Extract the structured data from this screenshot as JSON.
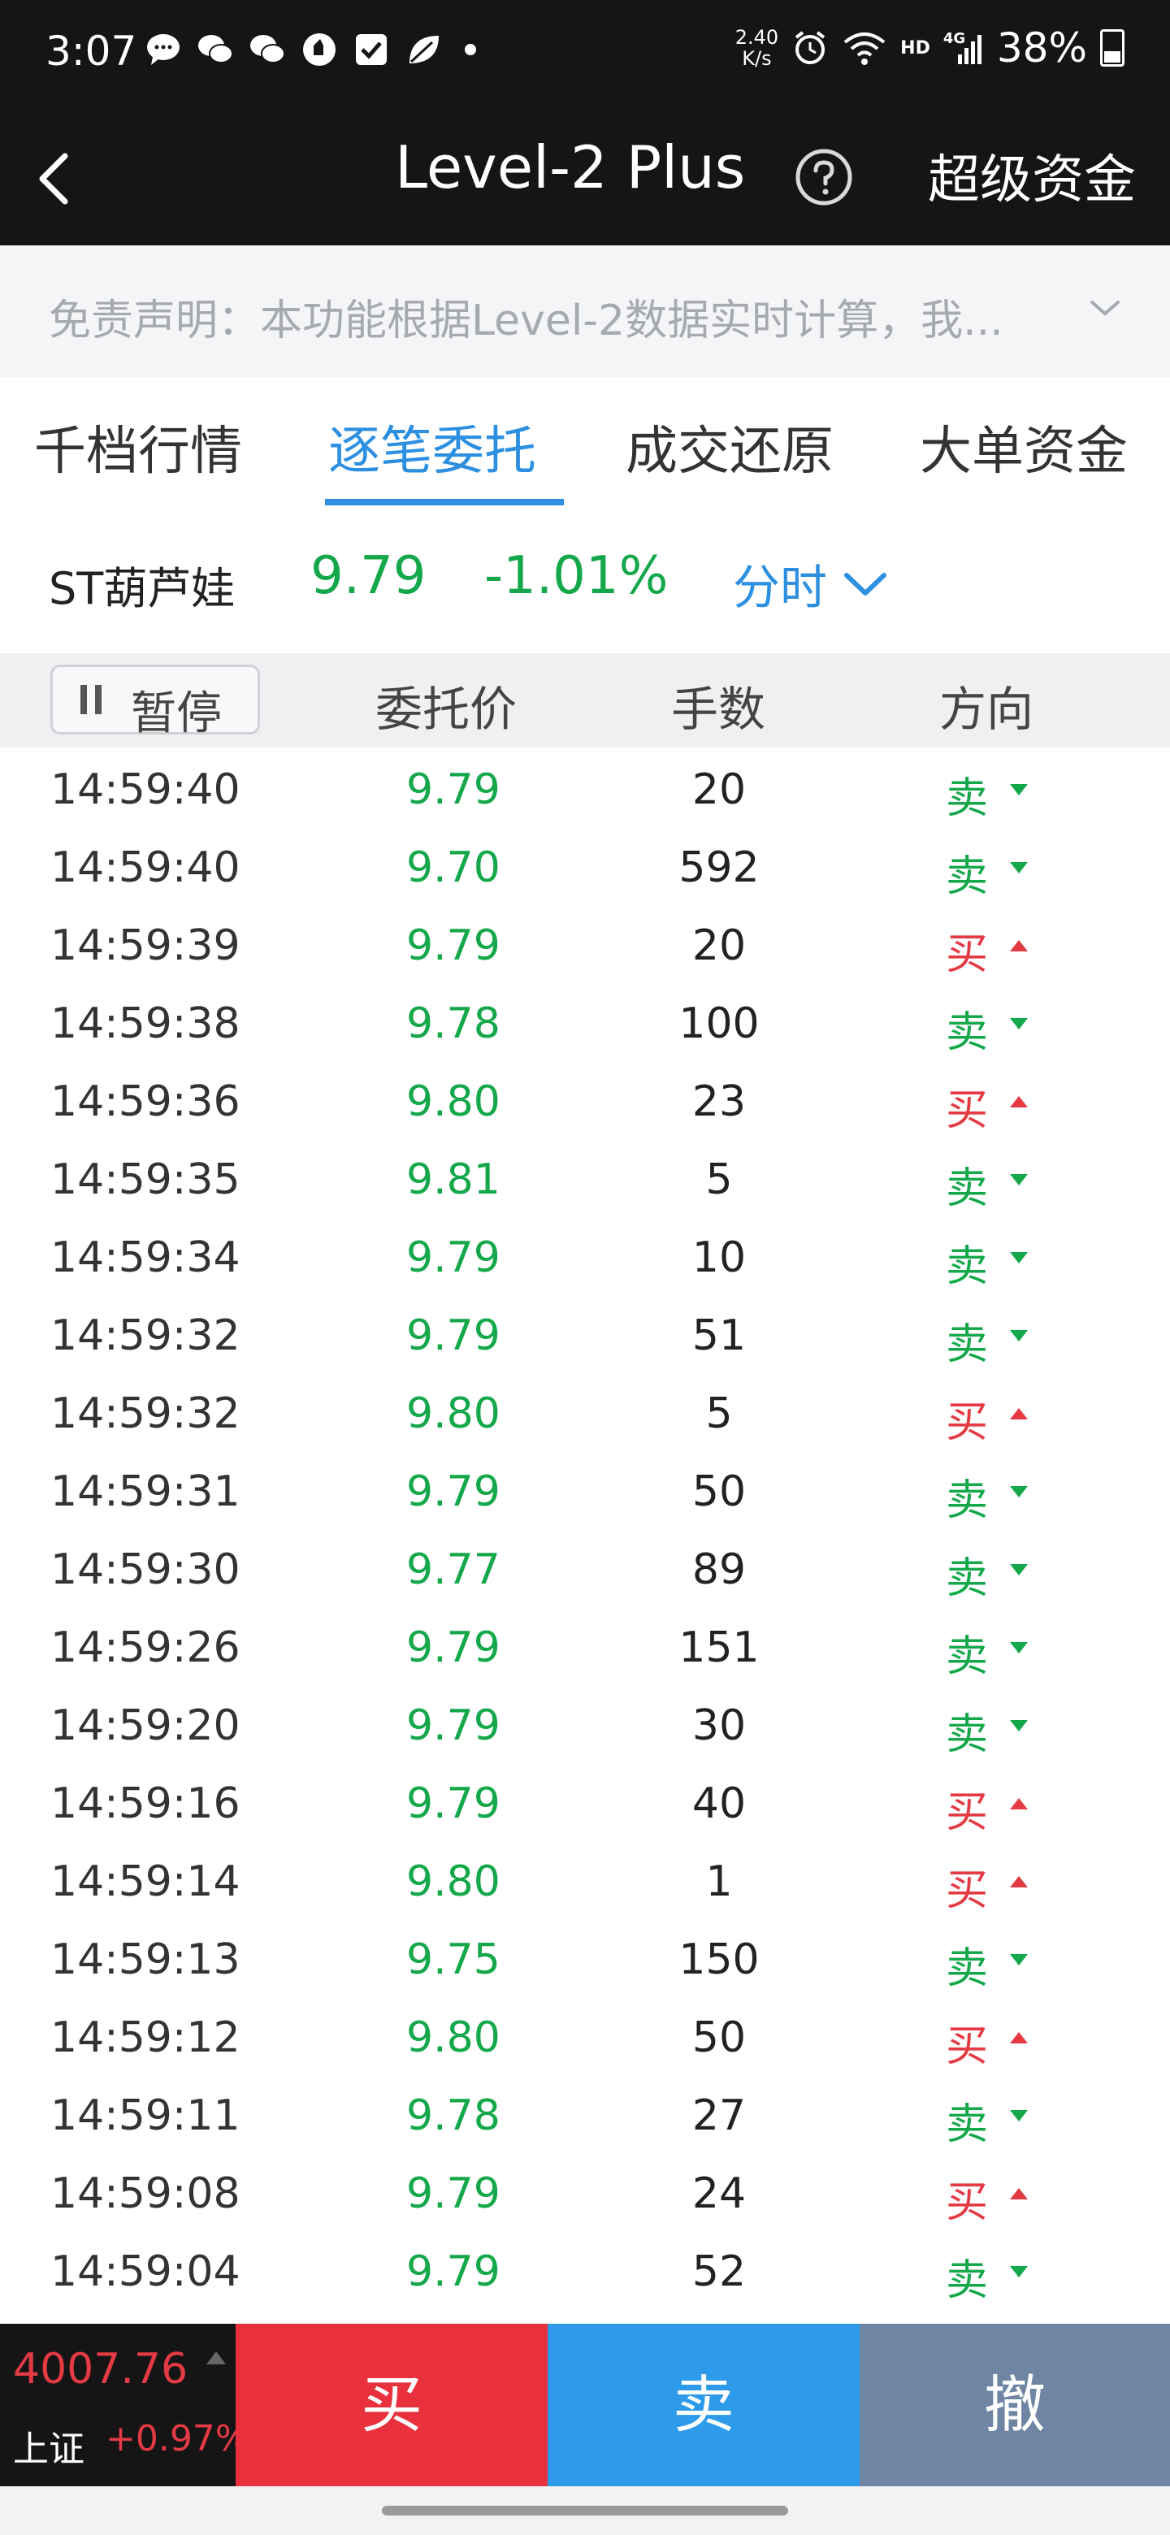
{
  "status_bar": {
    "time": "3:07",
    "net_speed_value": "2.40",
    "net_speed_unit": "K/s",
    "network_hd": "HD",
    "network_4g": "4G",
    "battery": "38%"
  },
  "nav": {
    "title": "Level-2 Plus",
    "right_label": "超级资金"
  },
  "disclaimer": {
    "text": "免责声明：本功能根据Level-2数据实时计算，我..."
  },
  "tabs": [
    {
      "label": "千档行情",
      "active": false
    },
    {
      "label": "逐笔委托",
      "active": true
    },
    {
      "label": "成交还原",
      "active": false
    },
    {
      "label": "大单资金",
      "active": false
    }
  ],
  "stock": {
    "name": "ST葫芦娃",
    "price": "9.79",
    "change_pct": "-1.01%",
    "timeframe": "分时"
  },
  "table": {
    "pause_label": "暂停",
    "columns": {
      "price": "委托价",
      "qty": "手数",
      "direction": "方向"
    },
    "rows": [
      {
        "time": "14:59:40",
        "price": "9.79",
        "qty": "20",
        "dir": "卖"
      },
      {
        "time": "14:59:40",
        "price": "9.70",
        "qty": "592",
        "dir": "卖"
      },
      {
        "time": "14:59:39",
        "price": "9.79",
        "qty": "20",
        "dir": "买"
      },
      {
        "time": "14:59:38",
        "price": "9.78",
        "qty": "100",
        "dir": "卖"
      },
      {
        "time": "14:59:36",
        "price": "9.80",
        "qty": "23",
        "dir": "买"
      },
      {
        "time": "14:59:35",
        "price": "9.81",
        "qty": "5",
        "dir": "卖"
      },
      {
        "time": "14:59:34",
        "price": "9.79",
        "qty": "10",
        "dir": "卖"
      },
      {
        "time": "14:59:32",
        "price": "9.79",
        "qty": "51",
        "dir": "卖"
      },
      {
        "time": "14:59:32",
        "price": "9.80",
        "qty": "5",
        "dir": "买"
      },
      {
        "time": "14:59:31",
        "price": "9.79",
        "qty": "50",
        "dir": "卖"
      },
      {
        "time": "14:59:30",
        "price": "9.77",
        "qty": "89",
        "dir": "卖"
      },
      {
        "time": "14:59:26",
        "price": "9.79",
        "qty": "151",
        "dir": "卖"
      },
      {
        "time": "14:59:20",
        "price": "9.79",
        "qty": "30",
        "dir": "卖"
      },
      {
        "time": "14:59:16",
        "price": "9.79",
        "qty": "40",
        "dir": "买"
      },
      {
        "time": "14:59:14",
        "price": "9.80",
        "qty": "1",
        "dir": "买"
      },
      {
        "time": "14:59:13",
        "price": "9.75",
        "qty": "150",
        "dir": "卖"
      },
      {
        "time": "14:59:12",
        "price": "9.80",
        "qty": "50",
        "dir": "买"
      },
      {
        "time": "14:59:11",
        "price": "9.78",
        "qty": "27",
        "dir": "卖"
      },
      {
        "time": "14:59:08",
        "price": "9.79",
        "qty": "24",
        "dir": "买"
      },
      {
        "time": "14:59:04",
        "price": "9.79",
        "qty": "52",
        "dir": "卖"
      }
    ]
  },
  "index": {
    "value": "4007.76",
    "name": "上证",
    "change": "+0.97%"
  },
  "actions": {
    "buy": "买",
    "sell": "卖",
    "cancel": "撤"
  },
  "colors": {
    "up": "#e33a43",
    "down": "#14a84b",
    "accent": "#2d8fe0"
  }
}
